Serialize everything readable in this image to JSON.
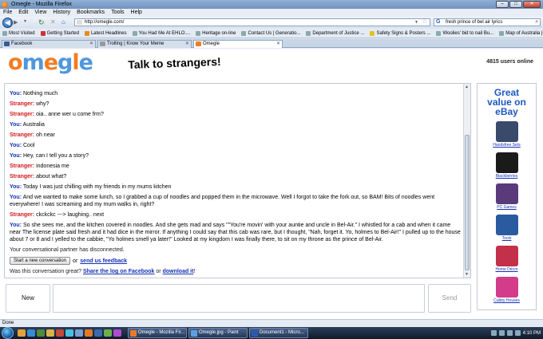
{
  "window": {
    "title": "Omegle - Mozilla Firefox",
    "buttons": {
      "minimize": "–",
      "maximize": "□",
      "close": "✕"
    }
  },
  "menu": [
    "File",
    "Edit",
    "View",
    "History",
    "Bookmarks",
    "Tools",
    "Help"
  ],
  "nav": {
    "url": "http://omegle.com/",
    "search_value": "fresh prince of bel air lyrics"
  },
  "bookmarks": [
    "Most Visited",
    "Getting Started",
    "Latest Headlines",
    "You Had Me At EHLO....",
    "Heritage on-line",
    "Contact Us | Generatio...",
    "Department of Justice ...",
    "Safety Signs & Posters ...",
    "Woolies' bid to nail Bu...",
    "Map of Australia |Curr..."
  ],
  "tabs": [
    {
      "label": "Facebook",
      "active": false
    },
    {
      "label": "Trolling | Know Your Meme",
      "active": false
    },
    {
      "label": "Omegle",
      "active": true
    }
  ],
  "header": {
    "logo_text": "omegle",
    "tagline": "Talk to strangers!",
    "users_online": "4815 users online"
  },
  "chat": {
    "messages": [
      {
        "speaker": "You:",
        "role": "you",
        "text": "Nothing much"
      },
      {
        "speaker": "Stranger:",
        "role": "stranger",
        "text": "why?"
      },
      {
        "speaker": "Stranger:",
        "role": "stranger",
        "text": "oia.. anne wer u come frm?"
      },
      {
        "speaker": "You:",
        "role": "you",
        "text": "Australia"
      },
      {
        "speaker": "Stranger:",
        "role": "stranger",
        "text": "oh near"
      },
      {
        "speaker": "You:",
        "role": "you",
        "text": "Cool"
      },
      {
        "speaker": "You:",
        "role": "you",
        "text": "Hey, can I tell you a story?"
      },
      {
        "speaker": "Stranger:",
        "role": "stranger",
        "text": "indonesia me"
      },
      {
        "speaker": "Stranger:",
        "role": "stranger",
        "text": "about what?"
      },
      {
        "speaker": "You:",
        "role": "you",
        "text": "Today I was just chilling with my friends in my mums kitchen"
      },
      {
        "speaker": "You:",
        "role": "you",
        "text": "And we wanted to make some lunch, so I grabbed a cup of noodles and popped them in the microwave. Well I forgot to take the fork out, so BAM! Bits of noodles went everywhere! I was screaming and my mum walks in, right?"
      },
      {
        "speaker": "Stranger:",
        "role": "stranger",
        "text": "ckckckc ---> laughing.. next"
      },
      {
        "speaker": "You:",
        "role": "you",
        "text": "So she sees me, and the kitchen covered in noodles. And she gets mad and says \"\"You're movin' with your auntie and uncle in Bel-Air.\" I whistled for a cab and when it came near The license plate said fresh and it had dice in the mirror. If anything I could say that this cab was rare, but I thought, \"Nah, forget it. Yo, holmes to Bel-Air!\" I pulled up to the house about 7 or 8 and I yelled to the cabbie, \"Yo holmes smell ya later!\" Looked at my kingdom I was finally there, to sit on my throne as the prince of Bel-Air."
      }
    ],
    "disconnected": "Your conversational partner has disconnected.",
    "new_conversation_label": "Start a new conversation",
    "or_text": "or",
    "feedback_link": "send us feedback",
    "great_question": "Was this conversation great?",
    "share_link": "Share the log on Facebook",
    "or_text2": "or",
    "download_link": "download it",
    "exclaim": "!"
  },
  "compose": {
    "new_label": "New",
    "send_label": "Send"
  },
  "ad": {
    "headline_line1": "Great",
    "headline_line2": "value on",
    "headline_line3": "eBay",
    "items": [
      {
        "label": "Handsfree Sets",
        "icon": "headset-icon",
        "color": "#3a4a6a"
      },
      {
        "label": "Blackberries",
        "icon": "phone-icon",
        "color": "#1a1a1a"
      },
      {
        "label": "PC Games",
        "icon": "game-box-icon",
        "color": "#5a3a7a"
      },
      {
        "label": "Tools",
        "icon": "drill-icon",
        "color": "#2a5aa0"
      },
      {
        "label": "Home Décor",
        "icon": "candles-icon",
        "color": "#c2304a"
      },
      {
        "label": "Cubby Houses",
        "icon": "cubby-house-icon",
        "color": "#d23c8a"
      }
    ]
  },
  "statusbar": {
    "text": "Done"
  },
  "taskbar": {
    "tasks": [
      "Omegle - Mozilla Fir...",
      "Omegle.jpg - Paint",
      "Document1 - Micro..."
    ],
    "clock": "4:10 PM"
  },
  "colors": {
    "you": "#1530b5",
    "stranger": "#d21a1a",
    "omegle_orange": "#f27d24",
    "omegle_blue": "#4f97de",
    "ebay_blue": "#1d58c0"
  }
}
